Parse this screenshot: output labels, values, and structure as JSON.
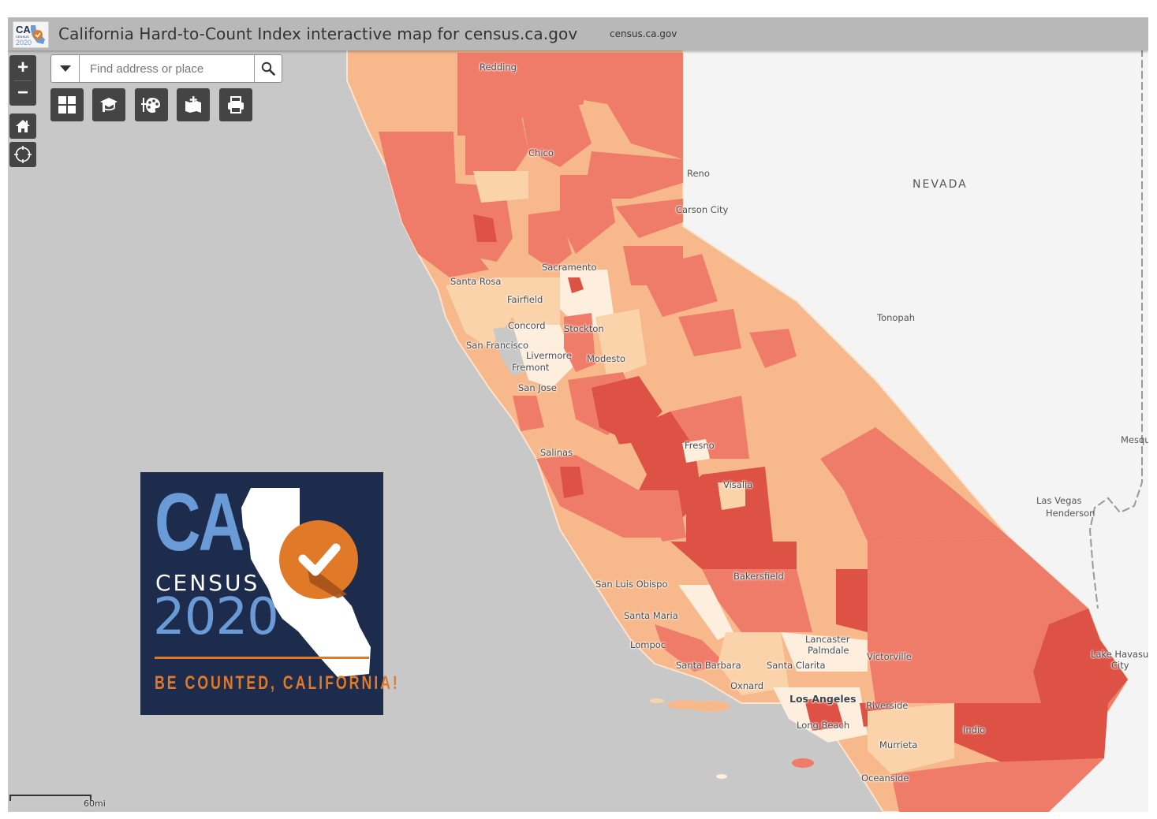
{
  "app": {
    "title": "California Hard-to-Count Index interactive map for census.ca.gov",
    "url_label": "census.ca.gov",
    "logo_icon": "ca-census-2020-logo"
  },
  "search": {
    "placeholder": "Find address or place",
    "value": "",
    "dropdown_icon": "caret-down-icon",
    "search_icon": "magnifier-icon"
  },
  "map_controls": {
    "zoom_in_label": "+",
    "zoom_out_label": "−",
    "home_icon": "home-icon",
    "locate_icon": "locate-crosshair-icon"
  },
  "toolbar": {
    "tools": [
      {
        "name": "basemap-gallery",
        "icon": "grid-icon"
      },
      {
        "name": "legend",
        "icon": "graduation-cap-icon"
      },
      {
        "name": "layer-style",
        "icon": "palette-icon"
      },
      {
        "name": "add-data",
        "icon": "map-plus-icon"
      },
      {
        "name": "print",
        "icon": "printer-icon"
      }
    ]
  },
  "map": {
    "state_labels": [
      "NEVADA"
    ],
    "city_labels": {
      "redding": "Redding",
      "chico": "Chico",
      "reno": "Reno",
      "carson_city": "Carson City",
      "sacramento": "Sacramento",
      "santa_rosa": "Santa Rosa",
      "fairfield": "Fairfield",
      "concord": "Concord",
      "stockton": "Stockton",
      "san_francisco": "San Francisco",
      "livermore": "Livermore",
      "fremont": "Fremont",
      "modesto": "Modesto",
      "san_jose": "San Jose",
      "tonopah": "Tonopah",
      "salinas": "Salinas",
      "fresno": "Fresno",
      "visalia": "Visalia",
      "mesquite": "Mesqu",
      "las_vegas": "Las Vegas",
      "henderson": "Henderson",
      "bakersfield": "Bakersfield",
      "san_luis_obispo": "San Luis Obispo",
      "santa_maria": "Santa Maria",
      "lompoc": "Lompoc",
      "lancaster": "Lancaster",
      "palmdale": "Palmdale",
      "victorville": "Victorville",
      "lake_havasu": "Lake Havasu",
      "lake_havasu_city": "City",
      "santa_barbara": "Santa Barbara",
      "santa_clarita": "Santa Clarita",
      "oxnard": "Oxnard",
      "los_angeles": "Los Angeles",
      "riverside": "Riverside",
      "long_beach": "Long Beach",
      "indio": "Indio",
      "murrieta": "Murrieta",
      "oceanside": "Oceanside"
    },
    "choropleth_colors": {
      "very_low": "#fdeedd",
      "low": "#fbd3aa",
      "moderate": "#f7b98c",
      "high": "#ef7c69",
      "very_high": "#dd5244"
    },
    "ocean_color": "#c8c8c8",
    "land_color": "#f4f4f4",
    "scale_label": "60mi"
  },
  "overlay_logo": {
    "ca": "CA",
    "census": "CENSUS",
    "year": "2020",
    "tagline": "BE COUNTED, CALIFORNIA!",
    "navy": "#1d2c4d",
    "blue": "#6a9bd6",
    "orange": "#e07a28"
  }
}
